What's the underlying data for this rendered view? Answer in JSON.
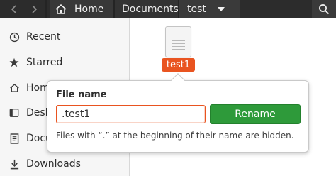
{
  "header": {
    "back_icon": "chevron-left-icon",
    "forward_icon": "chevron-right-icon",
    "breadcrumbs": [
      {
        "label": "Home",
        "icon": "home-icon"
      },
      {
        "label": "Documents"
      },
      {
        "label": "test",
        "icon": "dropdown-arrow-icon"
      }
    ],
    "search_icon": "search-icon"
  },
  "sidebar": {
    "items": [
      {
        "label": "Recent",
        "icon": "clock-icon"
      },
      {
        "label": "Starred",
        "icon": "star-icon"
      },
      {
        "label": "Home",
        "icon": "home-icon"
      },
      {
        "label": "Desktop",
        "icon": "desktop-icon"
      },
      {
        "label": "Documents",
        "icon": "document-icon"
      },
      {
        "label": "Downloads",
        "icon": "download-icon"
      }
    ]
  },
  "main": {
    "file": {
      "name": "test1",
      "icon": "text-file-icon"
    }
  },
  "rename_popover": {
    "title": "File name",
    "input_value": ".test1",
    "button_label": "Rename",
    "hint": "Files with “.” at the beginning of their name are hidden."
  },
  "colors": {
    "header_bg": "#2c2c2c",
    "accent": "#e95420",
    "button_green": "#2e9a3a",
    "sidebar_bg": "#f6f6f6"
  }
}
